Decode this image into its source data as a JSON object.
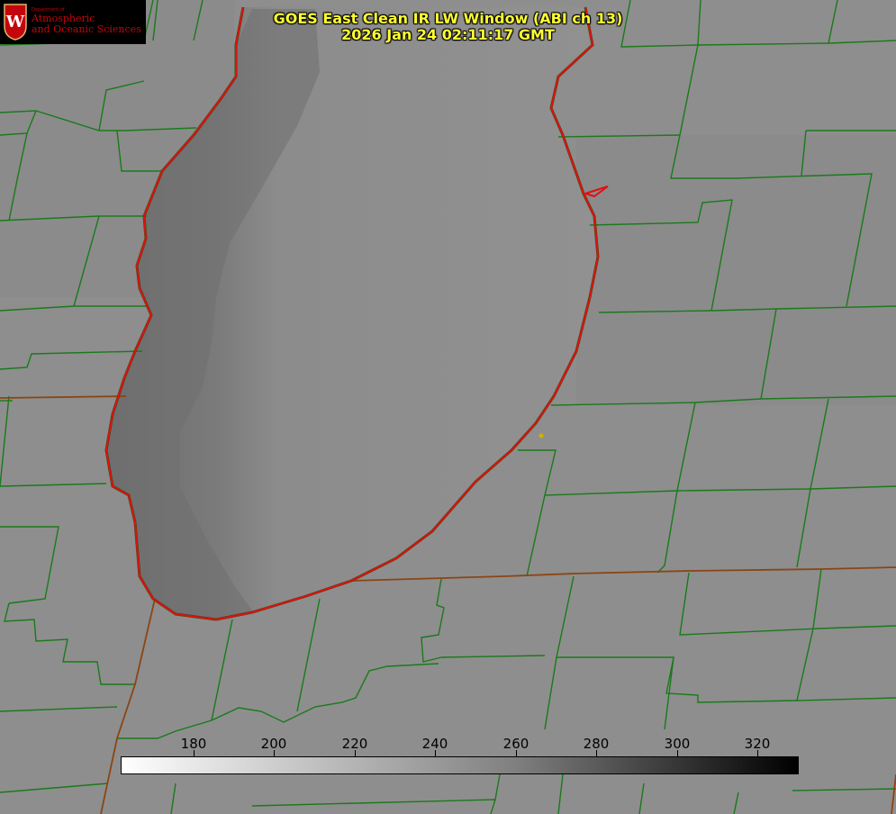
{
  "title": {
    "line1": "GOES East Clean IR LW Window (ABI ch 13)",
    "line2": "2026 Jan 24 02:11:17 GMT"
  },
  "logo": {
    "dept": "Department of",
    "name_line1": "Atmospheric",
    "name_line2": "and Oceanic Sciences",
    "crest_letter": "W",
    "icon": "uw-crest-icon"
  },
  "colorbar": {
    "ticks": [
      "180",
      "200",
      "220",
      "240",
      "260",
      "280",
      "300",
      "320"
    ],
    "palette_start": "#ffffff",
    "palette_end": "#000000"
  },
  "map": {
    "features": [
      "lake-michigan-shoreline",
      "county-boundaries",
      "state-boundaries",
      "station-marker"
    ],
    "colors": {
      "land": "#8f8f8f",
      "lake": "#909090",
      "cold_band": "#707070",
      "shoreline": "#e01010",
      "county": "#1a7a1a",
      "state": "#8b4513",
      "station": "#d4b000"
    }
  }
}
